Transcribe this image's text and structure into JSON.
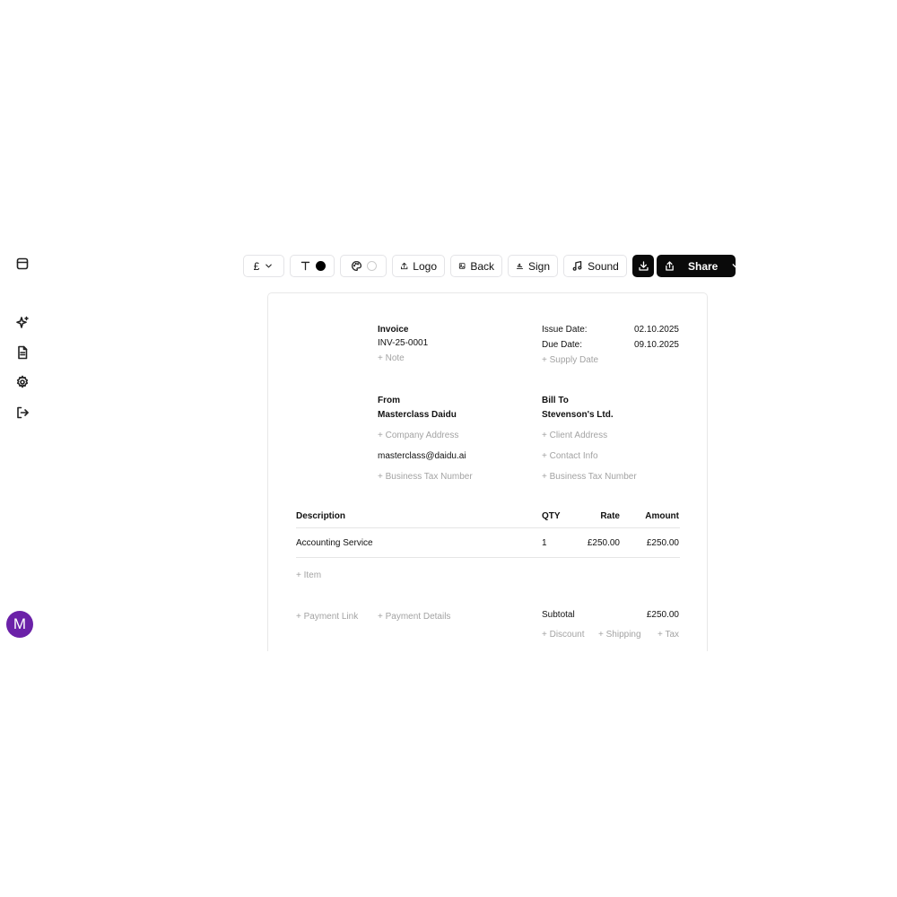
{
  "sidebar": {
    "icons": [
      "panel-icon",
      "sparkles-icon",
      "document-icon",
      "gear-icon",
      "logout-icon"
    ],
    "avatar_initial": "M",
    "avatar_color": "#6b21a8"
  },
  "toolbar": {
    "currency": "£",
    "font_color": "#000000",
    "theme_color": "#ffffff",
    "logo_label": "Logo",
    "back_label": "Back",
    "sign_label": "Sign",
    "sound_label": "Sound",
    "share_label": "Share"
  },
  "invoice": {
    "title": "Invoice",
    "number": "INV-25-0001",
    "note_add": "+ Note",
    "issue_date_label": "Issue Date:",
    "issue_date": "02.10.2025",
    "due_date_label": "Due Date:",
    "due_date": "09.10.2025",
    "supply_date_add": "+ Supply Date",
    "from": {
      "heading": "From",
      "name": "Masterclass Daidu",
      "address_add": "+ Company Address",
      "email": "masterclass@daidu.ai",
      "tax_add": "+ Business Tax Number"
    },
    "bill_to": {
      "heading": "Bill To",
      "name": "Stevenson's Ltd.",
      "address_add": "+ Client Address",
      "contact_add": "+ Contact Info",
      "tax_add": "+ Business Tax Number"
    },
    "table": {
      "headers": {
        "description": "Description",
        "qty": "QTY",
        "rate": "Rate",
        "amount": "Amount"
      },
      "rows": [
        {
          "description": "Accounting Service",
          "qty": "1",
          "rate": "£250.00",
          "amount": "£250.00"
        }
      ],
      "item_add": "+ Item"
    },
    "payment_link_add": "+ Payment Link",
    "payment_details_add": "+ Payment Details",
    "subtotal_label": "Subtotal",
    "subtotal_value": "£250.00",
    "discount_add": "+ Discount",
    "shipping_add": "+ Shipping",
    "tax_add": "+ Tax"
  }
}
